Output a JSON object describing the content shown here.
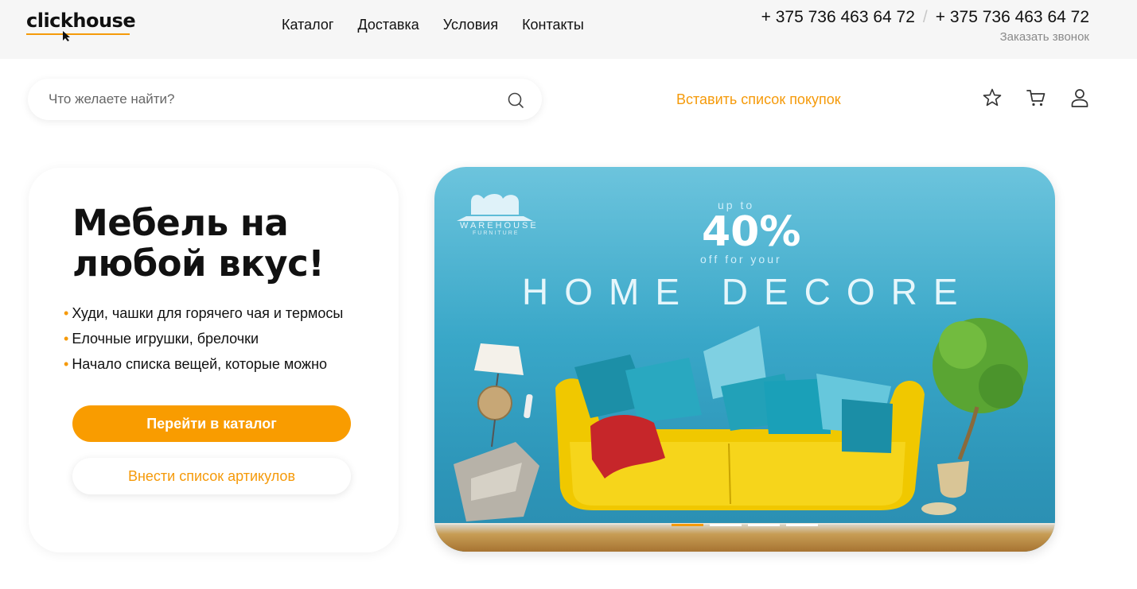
{
  "header": {
    "logo_text": "clickhouse",
    "nav": [
      "Каталог",
      "Доставка",
      "Условия",
      "Контакты"
    ],
    "phone_1": "+ 375 736 463 64 72",
    "phone_separator": "/",
    "phone_2": "+ 375 736 463 64 72",
    "callback_label": "Заказать звонок"
  },
  "search": {
    "placeholder": "Что желаете найти?",
    "value": "",
    "icon": "search-icon"
  },
  "actions": {
    "paste_list_label": "Вставить список покупок",
    "favorites_icon": "star-icon",
    "cart_icon": "cart-icon",
    "profile_icon": "user-icon"
  },
  "promo": {
    "title": "Мебель на любой вкус!",
    "bullets": [
      "Худи, чашки для горячего чая и термосы",
      "Елочные игрушки, брелочки",
      "Начало списка вещей, которые можно"
    ],
    "primary_button": "Перейти в каталог",
    "secondary_button": "Внести список артикулов"
  },
  "banner": {
    "brand": "WAREHOUSE",
    "brand_sub": "FURNITURE",
    "up_to": "up to",
    "discount": "40%",
    "off_for": "off for your",
    "headline": "HOME DECORE",
    "slides_total": 4,
    "active_slide": 1
  },
  "colors": {
    "accent": "#f99c00",
    "topbar_bg": "#f6f6f6",
    "text": "#111111",
    "muted": "#8a8a8a"
  }
}
